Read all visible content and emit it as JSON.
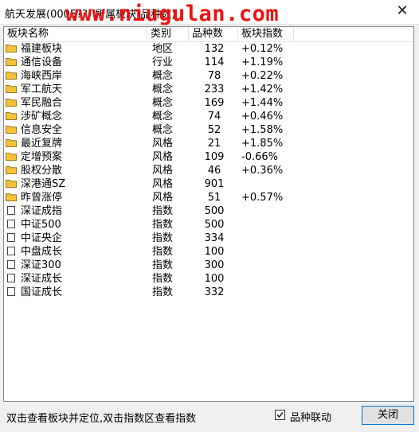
{
  "window": {
    "title": "航天发展(0005??) 所属板块(品种数)",
    "watermark": "www.niugulan.com",
    "close_glyph": "✕"
  },
  "table": {
    "headers": [
      "板块名称",
      "类别",
      "品种数",
      "板块指数"
    ],
    "rows": [
      {
        "name": "福建板块",
        "type": "地区",
        "count": "132",
        "index": "+0.12%",
        "icon": "folder-icon"
      },
      {
        "name": "通信设备",
        "type": "行业",
        "count": "114",
        "index": "+1.19%",
        "icon": "folder-icon"
      },
      {
        "name": "海峡西岸",
        "type": "概念",
        "count": "78",
        "index": "+0.22%",
        "icon": "folder-icon"
      },
      {
        "name": "军工航天",
        "type": "概念",
        "count": "233",
        "index": "+1.42%",
        "icon": "folder-icon"
      },
      {
        "name": "军民融合",
        "type": "概念",
        "count": "169",
        "index": "+1.44%",
        "icon": "folder-icon"
      },
      {
        "name": "涉矿概念",
        "type": "概念",
        "count": "74",
        "index": "+0.46%",
        "icon": "folder-icon"
      },
      {
        "name": "信息安全",
        "type": "概念",
        "count": "52",
        "index": "+1.58%",
        "icon": "folder-icon"
      },
      {
        "name": "最近复牌",
        "type": "风格",
        "count": "21",
        "index": "+1.85%",
        "icon": "folder-icon"
      },
      {
        "name": "定增预案",
        "type": "风格",
        "count": "109",
        "index": "-0.66%",
        "icon": "folder-icon"
      },
      {
        "name": "股权分散",
        "type": "风格",
        "count": "46",
        "index": "+0.36%",
        "icon": "folder-icon"
      },
      {
        "name": "深港通SZ",
        "type": "风格",
        "count": "901",
        "index": "",
        "icon": "folder-icon"
      },
      {
        "name": "昨曾涨停",
        "type": "风格",
        "count": "51",
        "index": "+0.57%",
        "icon": "folder-icon"
      },
      {
        "name": "深证成指",
        "type": "指数",
        "count": "500",
        "index": "",
        "icon": "document-icon"
      },
      {
        "name": "中证500",
        "type": "指数",
        "count": "500",
        "index": "",
        "icon": "document-icon"
      },
      {
        "name": "中证央企",
        "type": "指数",
        "count": "334",
        "index": "",
        "icon": "document-icon"
      },
      {
        "name": "中盘成长",
        "type": "指数",
        "count": "100",
        "index": "",
        "icon": "document-icon"
      },
      {
        "name": "深证300",
        "type": "指数",
        "count": "300",
        "index": "",
        "icon": "document-icon"
      },
      {
        "name": "深证成长",
        "type": "指数",
        "count": "100",
        "index": "",
        "icon": "document-icon"
      },
      {
        "name": "国证成长",
        "type": "指数",
        "count": "332",
        "index": "",
        "icon": "document-icon"
      }
    ]
  },
  "footer": {
    "hint": "双击查看板块并定位,双击指数区查看指数",
    "checkbox_label": "品种联动",
    "checkbox_checked": true,
    "close_button": "关闭"
  },
  "colors": {
    "folder": "#f5c23a",
    "watermark": "#ee1111",
    "focus_border": "#0078d7"
  }
}
